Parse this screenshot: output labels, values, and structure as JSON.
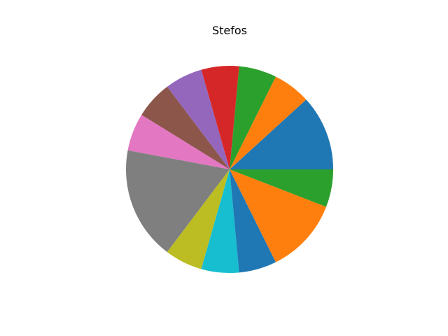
{
  "chart_data": {
    "type": "pie",
    "title": "Stefos",
    "start_angle_deg": 0,
    "direction": "counterclockwise",
    "slices": [
      {
        "value": 2,
        "color": "#1f77b4"
      },
      {
        "value": 1,
        "color": "#ff7f0e"
      },
      {
        "value": 1,
        "color": "#2ca02c"
      },
      {
        "value": 1,
        "color": "#d62728"
      },
      {
        "value": 1,
        "color": "#9467bd"
      },
      {
        "value": 1,
        "color": "#8c564b"
      },
      {
        "value": 1,
        "color": "#e377c2"
      },
      {
        "value": 3,
        "color": "#7f7f7f"
      },
      {
        "value": 1,
        "color": "#bcbd22"
      },
      {
        "value": 1,
        "color": "#17becf"
      },
      {
        "value": 1,
        "color": "#1f77b4"
      },
      {
        "value": 2,
        "color": "#ff7f0e"
      },
      {
        "value": 1,
        "color": "#2ca02c"
      }
    ]
  }
}
